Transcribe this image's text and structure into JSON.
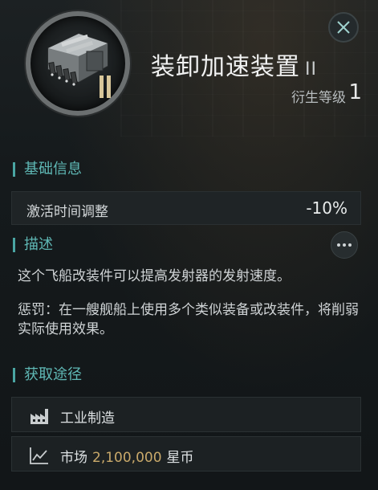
{
  "header": {
    "title": "装卸加速装置",
    "tier": "II",
    "icon_tier": "II",
    "meta_label": "衍生等级",
    "meta_value": "1"
  },
  "sections": {
    "basic_info": "基础信息",
    "description": "描述",
    "sources": "获取途径"
  },
  "attributes": [
    {
      "label": "激活时间调整",
      "value": "-10%"
    }
  ],
  "description": {
    "text": "这个飞船改装件可以提高发射器的发射速度。",
    "penalty": "惩罚：在一艘舰船上使用多个类似装备或改装件，将削弱实际使用效果。"
  },
  "sources": [
    {
      "icon": "factory-icon",
      "label": "工业制造"
    },
    {
      "icon": "market-chart-icon",
      "label": "市场",
      "price": "2,100,000",
      "currency": "星币"
    }
  ],
  "colors": {
    "accent": "#5fb8b5",
    "price": "#c9a96a",
    "background": "#151a1c"
  }
}
